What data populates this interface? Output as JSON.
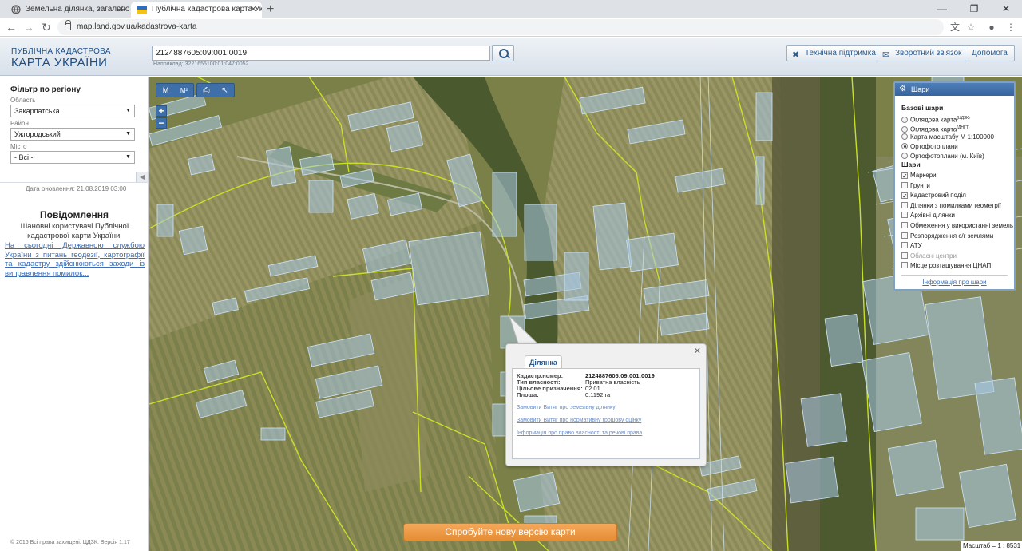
{
  "browser": {
    "tabs": [
      {
        "title": "Земельна ділянка, загальною п…"
      },
      {
        "title": "Публічна кадастрова карта Укр…"
      }
    ],
    "url": "map.land.gov.ua/kadastrova-karta"
  },
  "header": {
    "logo_line1": "ПУБЛІЧНА КАДАСТРОВА",
    "logo_line2": "КАРТА УКРАЇНИ",
    "search_value": "2124887605:09:001:0019",
    "search_example": "Наприклад: 3221655100:01:047:0052",
    "buttons": {
      "support": "Технічна підтримка",
      "feedback": "Зворотний зв'язок",
      "help": "Допомога"
    }
  },
  "filter": {
    "title": "Фільтр по регіону",
    "region_label": "Область",
    "region_value": "Закарпатська",
    "district_label": "Район",
    "district_value": "Ужгородський",
    "city_label": "Місто",
    "city_value": "- Всі -",
    "updated": "Дата оновлення: 21.08.2019 03:00"
  },
  "messages": {
    "title": "Повідомлення",
    "text": "Шановні користувачі Публічної кадастрової карти України!",
    "link": "На сьогодні Державною службою України з питань геодезії, картографії та кадастру здійснюються заходи із виправлення помилок..."
  },
  "footer": {
    "copyright": "© 2016 Всі права захищені. ЦДЗК. Версія 1.17"
  },
  "map_tools": {
    "measure_label": "М",
    "measure_area_label": "М²"
  },
  "layers": {
    "title": "Шари",
    "base_title": "Базові шари",
    "base": [
      {
        "label": "Оглядова карта",
        "sup": "(ЦДЗК)",
        "on": false
      },
      {
        "label": "Оглядова карта",
        "sup": "(ДНГТ)",
        "on": false
      },
      {
        "label": "Карта масштабу М 1:100000",
        "sup": "",
        "on": false
      },
      {
        "label": "Ортофотоплани",
        "sup": "",
        "on": true
      },
      {
        "label": "Ортофотоплани (м. Київ)",
        "sup": "",
        "on": false
      }
    ],
    "layers_title": "Шари",
    "items": [
      {
        "label": "Маркери",
        "on": true,
        "dim": false
      },
      {
        "label": "Ґрунти",
        "on": false,
        "dim": false
      },
      {
        "label": "Кадастровий поділ",
        "on": true,
        "dim": false
      },
      {
        "label": "Ділянки з помилками геометрії",
        "on": false,
        "dim": false
      },
      {
        "label": "Архівні ділянки",
        "on": false,
        "dim": false
      },
      {
        "label": "Обмеження у використанні земель",
        "on": false,
        "dim": false
      },
      {
        "label": "Розпорядження с/г землями",
        "on": false,
        "dim": false
      },
      {
        "label": "АТУ",
        "on": false,
        "dim": false
      },
      {
        "label": "Обласні центри",
        "on": false,
        "dim": true
      },
      {
        "label": "Місце розташування ЦНАП",
        "on": false,
        "dim": false
      }
    ],
    "info_link": "Інформація про шари"
  },
  "popup": {
    "tab": "Ділянка",
    "fields": [
      {
        "key": "Кадастр.номер:",
        "value": "2124887605:09:001:0019"
      },
      {
        "key": "Тип власності:",
        "value": "Приватна власність"
      },
      {
        "key": "Цільове призначення:",
        "value": "02.01"
      },
      {
        "key": "Площа:",
        "value": "0.1192 га"
      }
    ],
    "links": [
      "Замовити Витяг про земельну ділянку",
      "Замовити Витяг про нормативну грошову оцінку",
      "Інформація про право власності та речові права"
    ]
  },
  "try_new": "Спробуйте нову версію карти",
  "scale": "Масштаб = 1 : 8531"
}
